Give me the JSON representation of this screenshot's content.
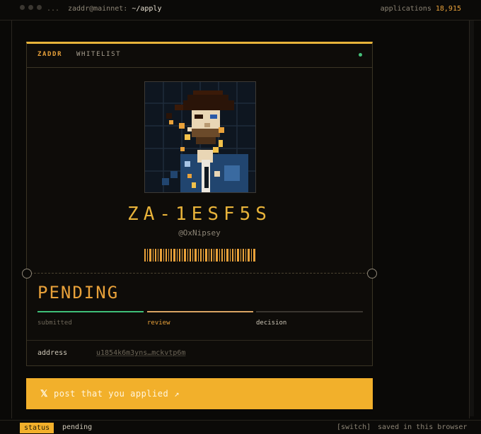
{
  "titlebar": {
    "ellipsis": "...",
    "user_host": "zaddr@mainnet:",
    "cwd": "~/apply",
    "applications_label": "applications",
    "applications_count": "18,915"
  },
  "card": {
    "brand": "ZADDR",
    "tag": "WHITELIST",
    "live_color": "#45c07a",
    "id": "ZA-1ESF5S",
    "handle": "@OxNipsey",
    "status": "PENDING",
    "steps": [
      {
        "label": "submitted",
        "state": "done",
        "color": "#3fbf78"
      },
      {
        "label": "review",
        "state": "current",
        "color": "#d9a463"
      },
      {
        "label": "decision",
        "state": "upcoming",
        "color": "#3a3630"
      }
    ],
    "address_label": "address",
    "address_value": "u1854k6m3yns…mckvtp6m"
  },
  "cta": {
    "icon": "x-logo-icon",
    "label": "post that you applied",
    "arrow": "↗"
  },
  "statusbar": {
    "key": "status",
    "value": "pending",
    "switch": "[switch]",
    "saved": "saved in this browser"
  },
  "colors": {
    "accent": "#f2b02b",
    "amber_text": "#e8a13a",
    "background": "#0a0907"
  }
}
